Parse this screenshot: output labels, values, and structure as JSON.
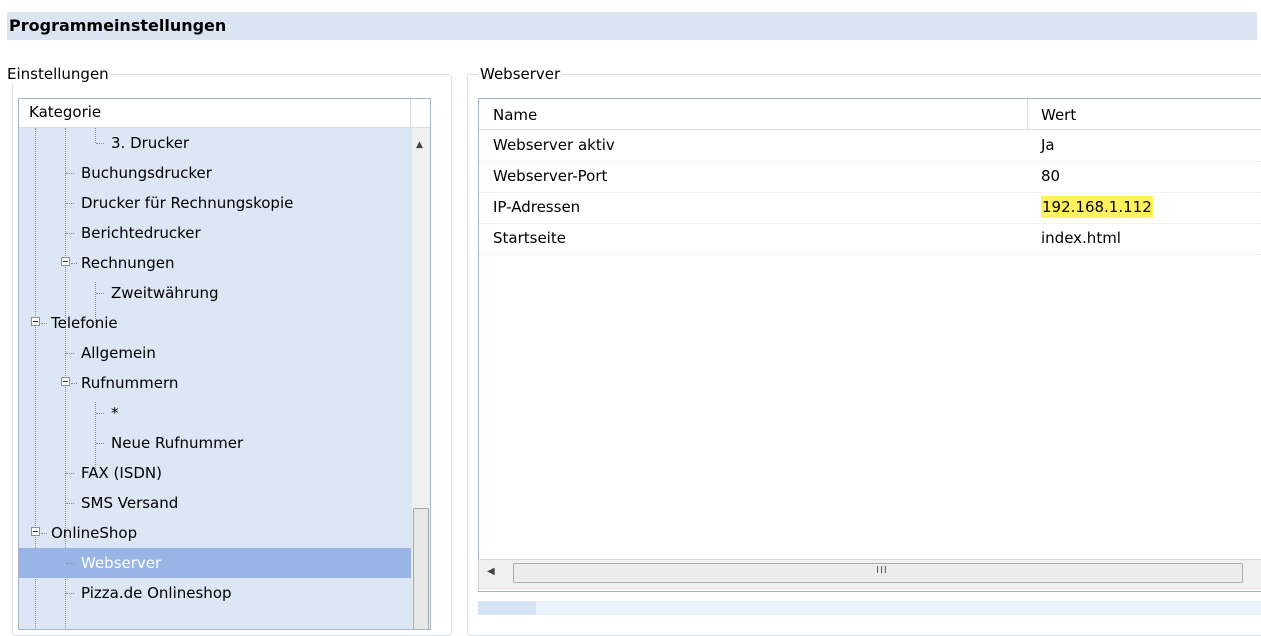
{
  "window": {
    "title": "Programmeinstellungen"
  },
  "settings_group": {
    "legend": "Einstellungen"
  },
  "tree": {
    "header": "Kategorie",
    "items": [
      {
        "label": "3. Drucker",
        "level": 3
      },
      {
        "label": "Buchungsdrucker",
        "level": 2
      },
      {
        "label": "Drucker für Rechnungskopie",
        "level": 2
      },
      {
        "label": "Berichtedrucker",
        "level": 2
      },
      {
        "label": "Rechnungen",
        "level": 2
      },
      {
        "label": "Zweitwährung",
        "level": 3
      },
      {
        "label": "Telefonie",
        "level": 1
      },
      {
        "label": "Allgemein",
        "level": 2
      },
      {
        "label": "Rufnummern",
        "level": 2
      },
      {
        "label": "*",
        "level": 3
      },
      {
        "label": "Neue Rufnummer",
        "level": 3
      },
      {
        "label": "FAX (ISDN)",
        "level": 2
      },
      {
        "label": "SMS Versand",
        "level": 2
      },
      {
        "label": "OnlineShop",
        "level": 1
      },
      {
        "label": "Webserver",
        "level": 2,
        "selected": true
      },
      {
        "label": "Pizza.de Onlineshop",
        "level": 2
      }
    ]
  },
  "webserver_group": {
    "legend": "Webserver"
  },
  "grid": {
    "columns": {
      "name": "Name",
      "value": "Wert"
    },
    "rows": [
      {
        "name": "Webserver aktiv",
        "value": "Ja"
      },
      {
        "name": "Webserver-Port",
        "value": "80"
      },
      {
        "name": "IP-Adressen",
        "value": "192.168.1.112",
        "highlighted": true
      },
      {
        "name": "Startseite",
        "value": "index.html"
      }
    ]
  },
  "scrollbars": {
    "horizontal_grip": "III"
  },
  "colors": {
    "highlight": "#fff25c",
    "selection": "#98b5e5",
    "tree_background": "#dce6f4",
    "title_background": "#dbe4f1"
  }
}
